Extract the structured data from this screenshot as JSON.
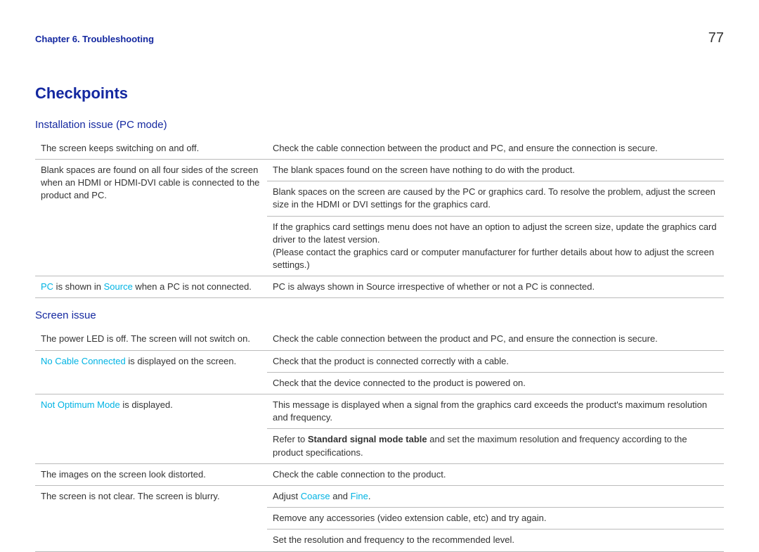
{
  "header": {
    "chapter": "Chapter 6. Troubleshooting",
    "page_number": "77"
  },
  "title": "Checkpoints",
  "sections": [
    {
      "heading": "Installation issue (PC mode)",
      "rows": [
        {
          "left": [
            {
              "plain": "The screen keeps switching on and off."
            }
          ],
          "rights": [
            "Check the cable connection between the product and PC, and ensure the connection is secure."
          ]
        },
        {
          "left": [
            {
              "plain": "Blank spaces are found on all four sides of the screen when an HDMI or HDMI-DVI cable is connected to the product and PC."
            }
          ],
          "rights": [
            "The blank spaces found on the screen have nothing to do with the product.",
            "Blank spaces on the screen are caused by the PC or graphics card. To resolve the problem, adjust the screen size in the HDMI or DVI settings for the graphics card.",
            "If the graphics card settings menu does not have an option to adjust the screen size, update the graphics card driver to the latest version.",
            "(Please contact the graphics card or computer manufacturer for further details about how to adjust the screen settings.)"
          ],
          "merge_last_two": true
        },
        {
          "left": [
            {
              "accent": "PC"
            },
            {
              "plain": " is shown in "
            },
            {
              "accent": "Source"
            },
            {
              "plain": " when a PC is not connected."
            }
          ],
          "rights": [
            "PC is always shown in Source irrespective of whether or not a PC is connected."
          ]
        }
      ]
    },
    {
      "heading": "Screen issue",
      "rows": [
        {
          "left": [
            {
              "plain": "The power LED is off. The screen will not switch on."
            }
          ],
          "rights": [
            "Check the cable connection between the product and PC, and ensure the connection is secure."
          ]
        },
        {
          "left": [
            {
              "accent": "No Cable Connected"
            },
            {
              "plain": " is displayed on the screen."
            }
          ],
          "rights": [
            "Check that the product is connected correctly with a cable.",
            "Check that the device connected to the product is powered on."
          ]
        },
        {
          "left": [
            {
              "accent": "Not Optimum Mode"
            },
            {
              "plain": " is displayed."
            }
          ],
          "rights": [
            "This message is displayed when a signal from the graphics card exceeds the product's maximum resolution and frequency.",
            {
              "segments": [
                {
                  "plain": "Refer to "
                },
                {
                  "bold": "Standard signal mode table"
                },
                {
                  "plain": " and set the maximum resolution and frequency according to the product specifications."
                }
              ]
            }
          ]
        },
        {
          "left": [
            {
              "plain": "The images on the screen look distorted."
            }
          ],
          "rights": [
            "Check the cable connection to the product."
          ]
        },
        {
          "left": [
            {
              "plain": "The screen is not clear. The screen is blurry."
            }
          ],
          "rights": [
            {
              "segments": [
                {
                  "plain": "Adjust "
                },
                {
                  "accent": "Coarse"
                },
                {
                  "plain": " and "
                },
                {
                  "accent": "Fine"
                },
                {
                  "plain": "."
                }
              ]
            },
            "Remove any accessories (video extension cable, etc) and try again.",
            "Set the resolution and frequency to the recommended level."
          ]
        }
      ]
    }
  ]
}
